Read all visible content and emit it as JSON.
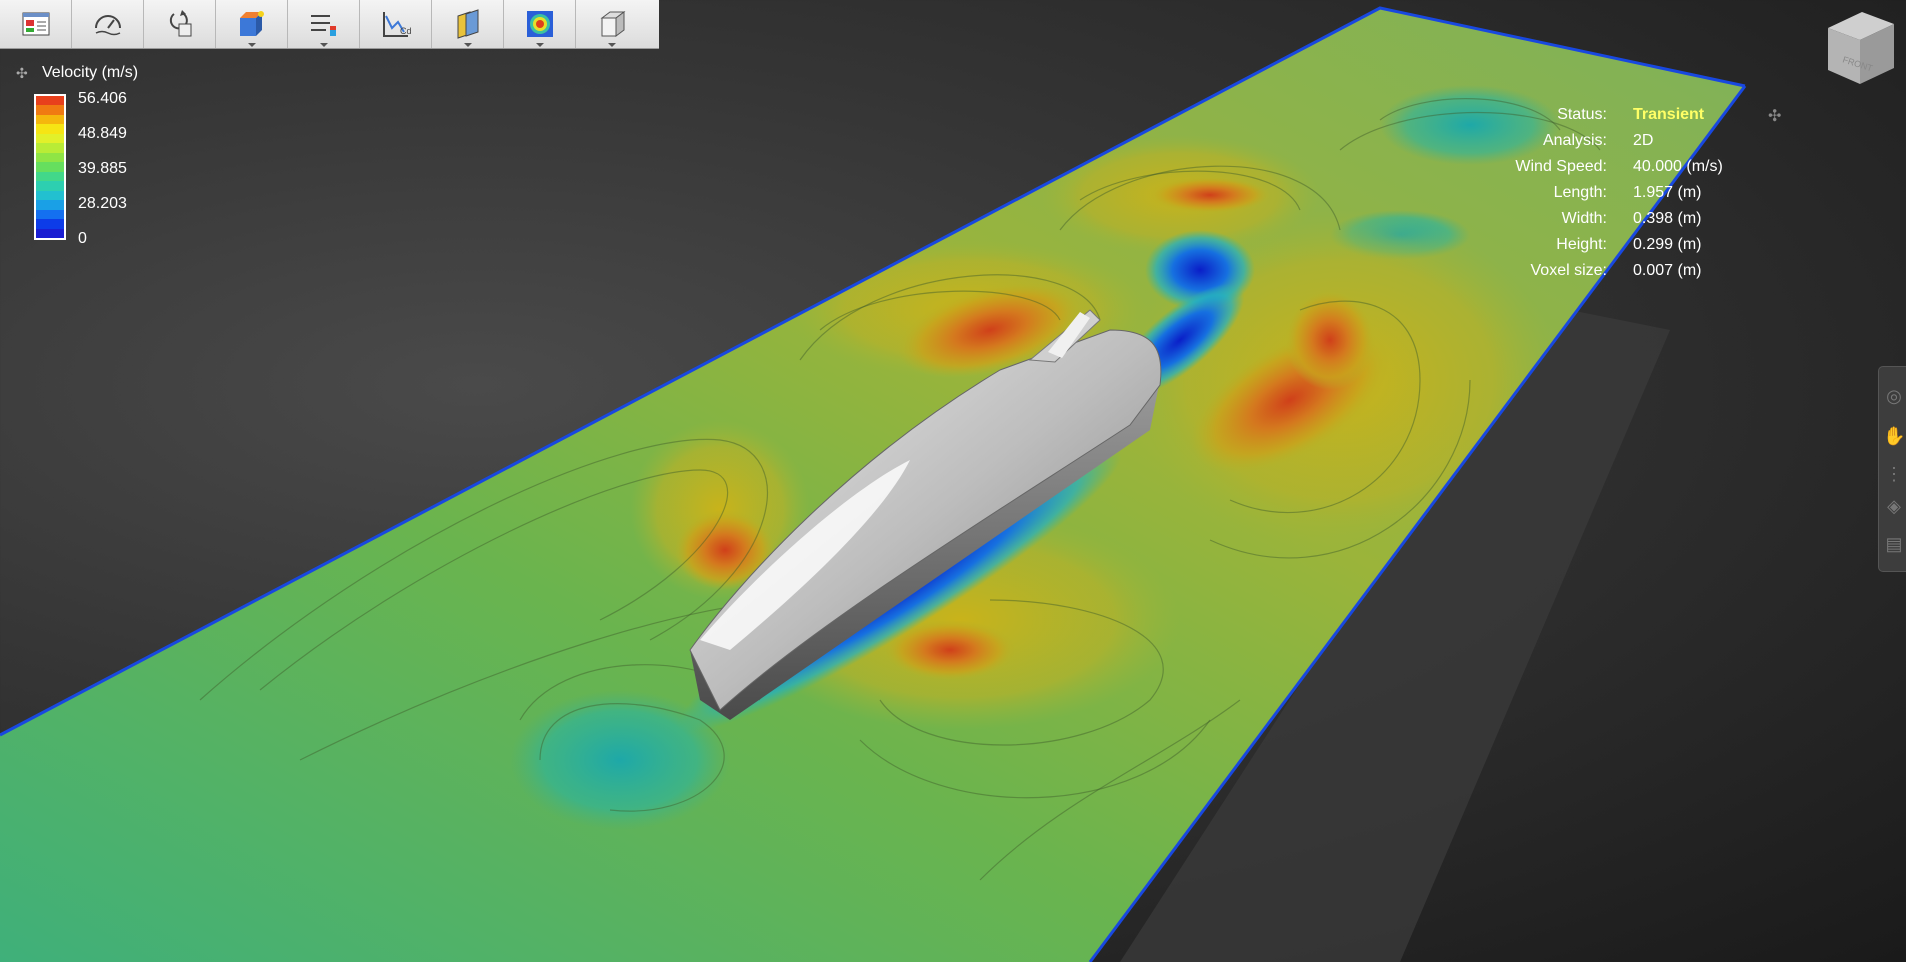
{
  "toolbar": {
    "tools": [
      {
        "icon": "setup-panel-icon",
        "has_dropdown": false
      },
      {
        "icon": "speedometer-icon",
        "has_dropdown": false
      },
      {
        "icon": "rotate-object-icon",
        "has_dropdown": false
      },
      {
        "icon": "color-box-icon",
        "has_dropdown": true
      },
      {
        "icon": "sliders-icon",
        "has_dropdown": true
      },
      {
        "icon": "plot-graph-icon",
        "has_dropdown": false
      },
      {
        "icon": "layers-icon",
        "has_dropdown": true
      },
      {
        "icon": "contour-map-icon",
        "has_dropdown": true
      },
      {
        "icon": "wireframe-cube-icon",
        "has_dropdown": true
      }
    ]
  },
  "legend": {
    "title": "Velocity (m/s)",
    "values": [
      "56.406",
      "48.849",
      "39.885",
      "28.203",
      "0"
    ],
    "colors": [
      "#e8401c",
      "#f07a12",
      "#f5b70d",
      "#f6e514",
      "#e2f02a",
      "#b9ec36",
      "#8fe545",
      "#66df5e",
      "#42d88a",
      "#2dcfb0",
      "#22c0d0",
      "#1aa0e6",
      "#1470f0",
      "#0d3ce8",
      "#1a1ed2"
    ]
  },
  "info": {
    "rows": [
      {
        "label": "Status:",
        "value": "Transient",
        "highlight": true
      },
      {
        "label": "Analysis:",
        "value": "2D"
      },
      {
        "label": "Wind Speed:",
        "value": "40.000 (m/s)"
      },
      {
        "label": "Length:",
        "value": "1.957 (m)"
      },
      {
        "label": "Width:",
        "value": "0.398 (m)"
      },
      {
        "label": "Height:",
        "value": "0.299 (m)"
      },
      {
        "label": "Voxel size:",
        "value": "0.007 (m)"
      }
    ]
  },
  "viewcube": {
    "face_label": "FRONT"
  },
  "sidepanel": {
    "icons": [
      "orbit-icon",
      "pan-hand-icon",
      "zoom-icon",
      "look-icon",
      "film-icon"
    ]
  },
  "colors": {
    "status_highlight": "#ffff66",
    "toolbar_bg": "#e6e6e6"
  }
}
